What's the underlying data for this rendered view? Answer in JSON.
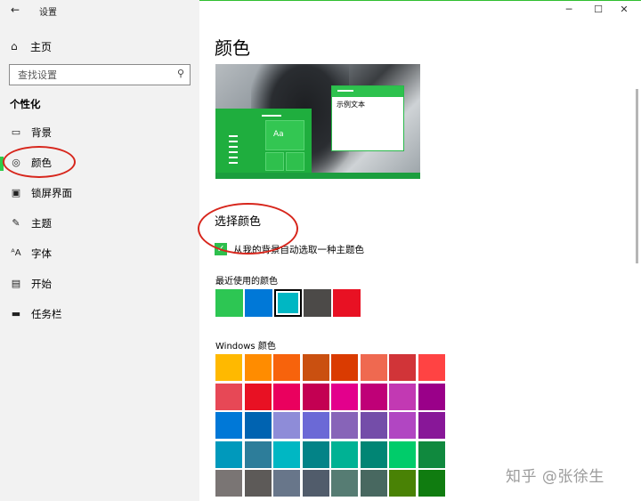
{
  "window": {
    "title": "设置",
    "back_icon": "arrow-left-icon",
    "minimize_icon": "minimize-icon",
    "maximize_icon": "maximize-icon",
    "close_icon": "close-icon"
  },
  "sidebar": {
    "home_label": "主页",
    "search_placeholder": "查找设置",
    "section_title": "个性化",
    "items": [
      {
        "label": "背景",
        "icon": "image-icon"
      },
      {
        "label": "颜色",
        "icon": "palette-icon",
        "active": true
      },
      {
        "label": "锁屏界面",
        "icon": "lock-screen-icon"
      },
      {
        "label": "主题",
        "icon": "theme-icon"
      },
      {
        "label": "字体",
        "icon": "font-icon"
      },
      {
        "label": "开始",
        "icon": "start-icon"
      },
      {
        "label": "任务栏",
        "icon": "taskbar-icon"
      }
    ]
  },
  "main": {
    "title": "颜色",
    "preview": {
      "tile_text": "Aa",
      "sample_text": "示例文本"
    },
    "choose_heading": "选择颜色",
    "auto_pick_label": "从我的背景自动选取一种主题色",
    "auto_pick_checked": true,
    "recent_label": "最近使用的颜色",
    "recent_colors": [
      "#2dc653",
      "#0078d7",
      "#00b7c3",
      "#4c4a48",
      "#e81123"
    ],
    "recent_selected_index": 2,
    "windows_label": "Windows 颜色",
    "windows_colors": [
      "#ffb900",
      "#ff8c00",
      "#f7630c",
      "#ca5010",
      "#da3b01",
      "#ef6950",
      "#d13438",
      "#ff4343",
      "#e74856",
      "#e81123",
      "#ea005e",
      "#c30052",
      "#e3008c",
      "#bf0077",
      "#c239b3",
      "#9a0089",
      "#0078d7",
      "#0063b1",
      "#8e8cd8",
      "#6b69d6",
      "#8764b8",
      "#744da9",
      "#b146c2",
      "#881798",
      "#0099bc",
      "#2d7d9a",
      "#00b7c3",
      "#038387",
      "#00b294",
      "#018574",
      "#00cc6a",
      "#10893e",
      "#7a7574",
      "#5d5a58",
      "#68768a",
      "#515c6b",
      "#567c73",
      "#486860",
      "#498205",
      "#107c10"
    ]
  },
  "watermark": "知乎 @张徐生"
}
